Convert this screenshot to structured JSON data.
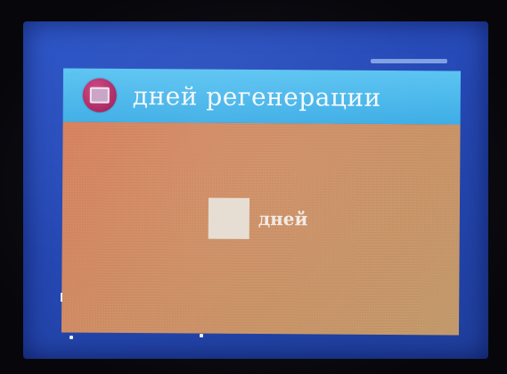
{
  "dialog": {
    "title": "дней регенерации",
    "icon": "window-icon",
    "value_field": {
      "value": "",
      "unit_label": "дней"
    }
  },
  "colors": {
    "screen_background": "#2548b4",
    "title_bar": "#3eaee6",
    "content_background": "#cf9066",
    "title_icon": "#a8245f"
  }
}
